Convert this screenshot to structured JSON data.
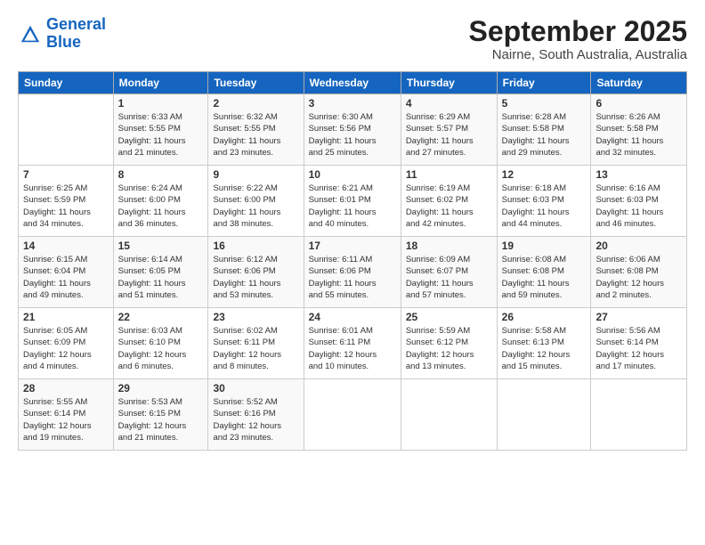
{
  "header": {
    "logo_line1": "General",
    "logo_line2": "Blue",
    "month": "September 2025",
    "location": "Nairne, South Australia, Australia"
  },
  "days_of_week": [
    "Sunday",
    "Monday",
    "Tuesday",
    "Wednesday",
    "Thursday",
    "Friday",
    "Saturday"
  ],
  "weeks": [
    [
      {
        "day": "",
        "text": ""
      },
      {
        "day": "1",
        "text": "Sunrise: 6:33 AM\nSunset: 5:55 PM\nDaylight: 11 hours\nand 21 minutes."
      },
      {
        "day": "2",
        "text": "Sunrise: 6:32 AM\nSunset: 5:55 PM\nDaylight: 11 hours\nand 23 minutes."
      },
      {
        "day": "3",
        "text": "Sunrise: 6:30 AM\nSunset: 5:56 PM\nDaylight: 11 hours\nand 25 minutes."
      },
      {
        "day": "4",
        "text": "Sunrise: 6:29 AM\nSunset: 5:57 PM\nDaylight: 11 hours\nand 27 minutes."
      },
      {
        "day": "5",
        "text": "Sunrise: 6:28 AM\nSunset: 5:58 PM\nDaylight: 11 hours\nand 29 minutes."
      },
      {
        "day": "6",
        "text": "Sunrise: 6:26 AM\nSunset: 5:58 PM\nDaylight: 11 hours\nand 32 minutes."
      }
    ],
    [
      {
        "day": "7",
        "text": "Sunrise: 6:25 AM\nSunset: 5:59 PM\nDaylight: 11 hours\nand 34 minutes."
      },
      {
        "day": "8",
        "text": "Sunrise: 6:24 AM\nSunset: 6:00 PM\nDaylight: 11 hours\nand 36 minutes."
      },
      {
        "day": "9",
        "text": "Sunrise: 6:22 AM\nSunset: 6:00 PM\nDaylight: 11 hours\nand 38 minutes."
      },
      {
        "day": "10",
        "text": "Sunrise: 6:21 AM\nSunset: 6:01 PM\nDaylight: 11 hours\nand 40 minutes."
      },
      {
        "day": "11",
        "text": "Sunrise: 6:19 AM\nSunset: 6:02 PM\nDaylight: 11 hours\nand 42 minutes."
      },
      {
        "day": "12",
        "text": "Sunrise: 6:18 AM\nSunset: 6:03 PM\nDaylight: 11 hours\nand 44 minutes."
      },
      {
        "day": "13",
        "text": "Sunrise: 6:16 AM\nSunset: 6:03 PM\nDaylight: 11 hours\nand 46 minutes."
      }
    ],
    [
      {
        "day": "14",
        "text": "Sunrise: 6:15 AM\nSunset: 6:04 PM\nDaylight: 11 hours\nand 49 minutes."
      },
      {
        "day": "15",
        "text": "Sunrise: 6:14 AM\nSunset: 6:05 PM\nDaylight: 11 hours\nand 51 minutes."
      },
      {
        "day": "16",
        "text": "Sunrise: 6:12 AM\nSunset: 6:06 PM\nDaylight: 11 hours\nand 53 minutes."
      },
      {
        "day": "17",
        "text": "Sunrise: 6:11 AM\nSunset: 6:06 PM\nDaylight: 11 hours\nand 55 minutes."
      },
      {
        "day": "18",
        "text": "Sunrise: 6:09 AM\nSunset: 6:07 PM\nDaylight: 11 hours\nand 57 minutes."
      },
      {
        "day": "19",
        "text": "Sunrise: 6:08 AM\nSunset: 6:08 PM\nDaylight: 11 hours\nand 59 minutes."
      },
      {
        "day": "20",
        "text": "Sunrise: 6:06 AM\nSunset: 6:08 PM\nDaylight: 12 hours\nand 2 minutes."
      }
    ],
    [
      {
        "day": "21",
        "text": "Sunrise: 6:05 AM\nSunset: 6:09 PM\nDaylight: 12 hours\nand 4 minutes."
      },
      {
        "day": "22",
        "text": "Sunrise: 6:03 AM\nSunset: 6:10 PM\nDaylight: 12 hours\nand 6 minutes."
      },
      {
        "day": "23",
        "text": "Sunrise: 6:02 AM\nSunset: 6:11 PM\nDaylight: 12 hours\nand 8 minutes."
      },
      {
        "day": "24",
        "text": "Sunrise: 6:01 AM\nSunset: 6:11 PM\nDaylight: 12 hours\nand 10 minutes."
      },
      {
        "day": "25",
        "text": "Sunrise: 5:59 AM\nSunset: 6:12 PM\nDaylight: 12 hours\nand 13 minutes."
      },
      {
        "day": "26",
        "text": "Sunrise: 5:58 AM\nSunset: 6:13 PM\nDaylight: 12 hours\nand 15 minutes."
      },
      {
        "day": "27",
        "text": "Sunrise: 5:56 AM\nSunset: 6:14 PM\nDaylight: 12 hours\nand 17 minutes."
      }
    ],
    [
      {
        "day": "28",
        "text": "Sunrise: 5:55 AM\nSunset: 6:14 PM\nDaylight: 12 hours\nand 19 minutes."
      },
      {
        "day": "29",
        "text": "Sunrise: 5:53 AM\nSunset: 6:15 PM\nDaylight: 12 hours\nand 21 minutes."
      },
      {
        "day": "30",
        "text": "Sunrise: 5:52 AM\nSunset: 6:16 PM\nDaylight: 12 hours\nand 23 minutes."
      },
      {
        "day": "",
        "text": ""
      },
      {
        "day": "",
        "text": ""
      },
      {
        "day": "",
        "text": ""
      },
      {
        "day": "",
        "text": ""
      }
    ]
  ]
}
